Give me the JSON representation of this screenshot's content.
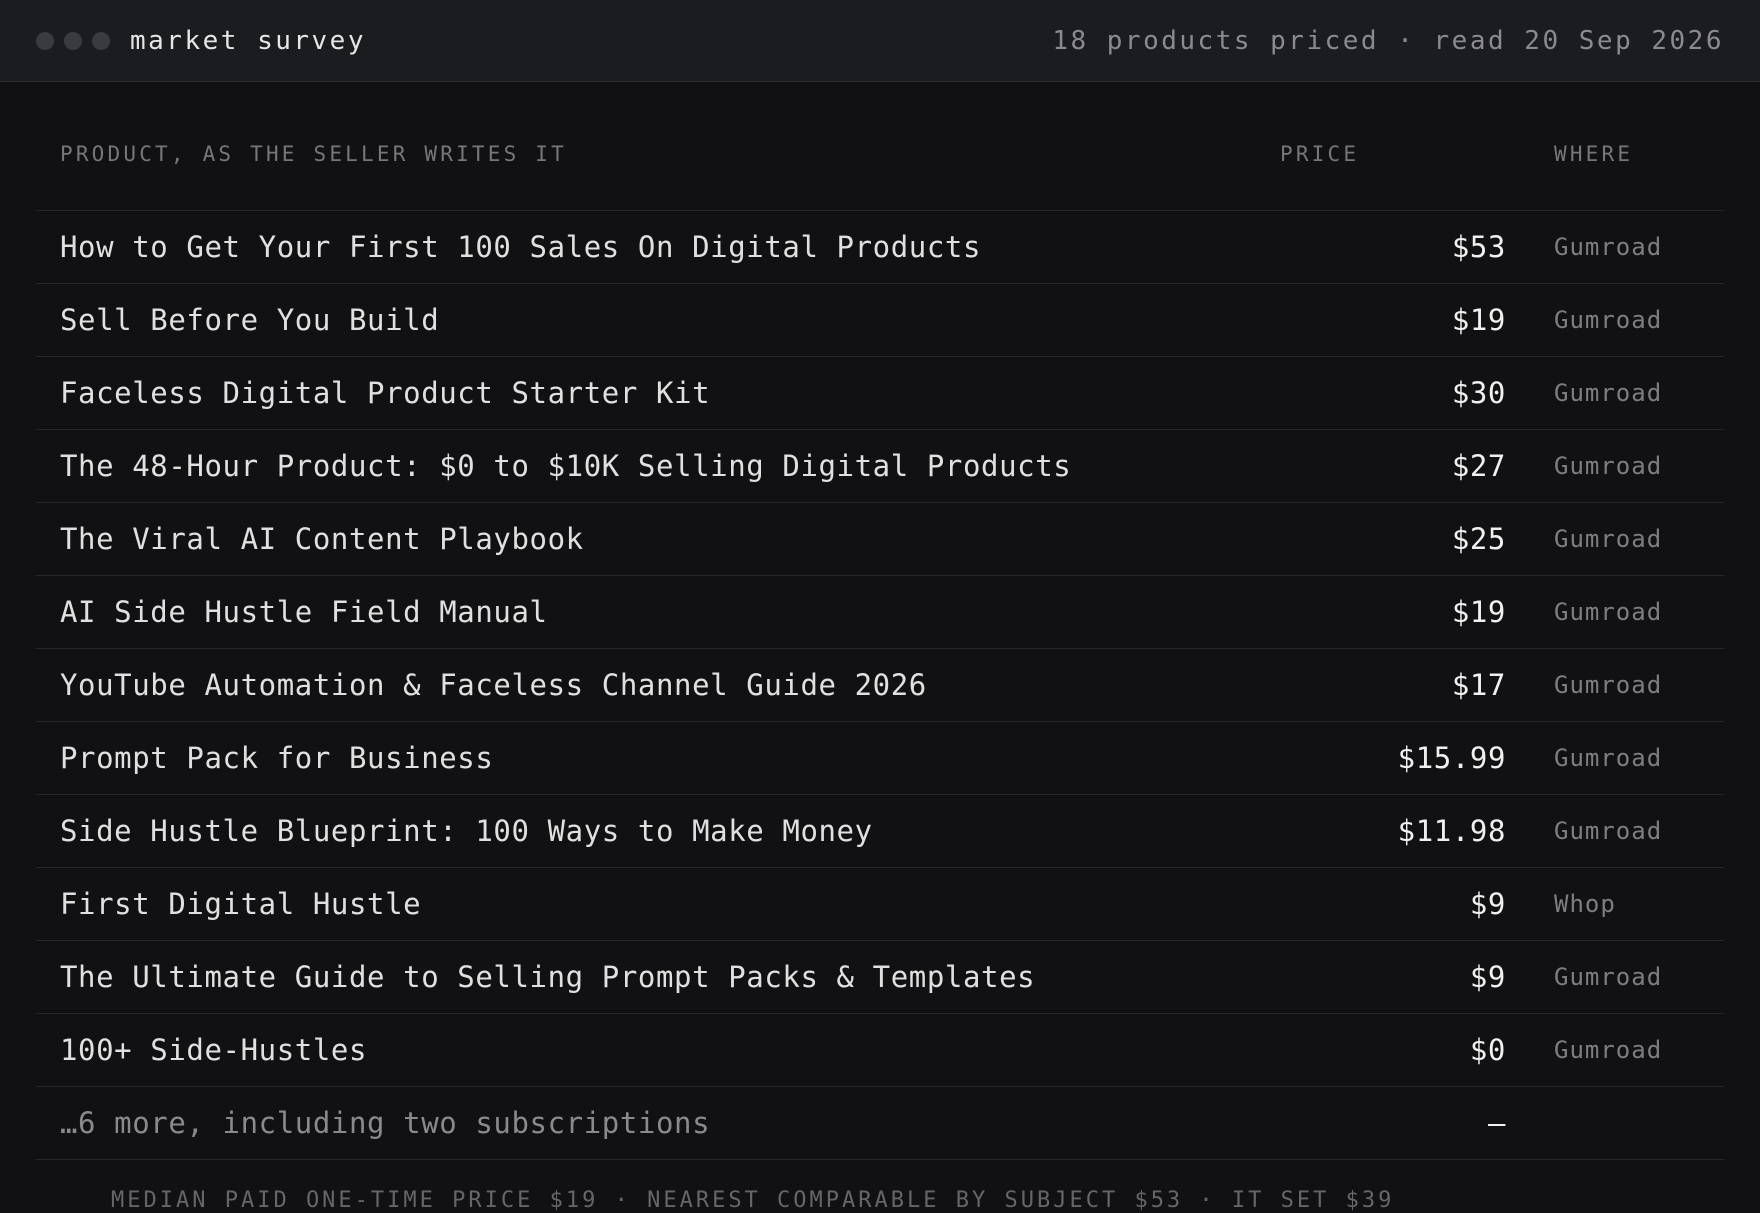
{
  "window": {
    "title": "market survey",
    "status": "18 products priced · read 20 Sep 2026"
  },
  "table": {
    "headers": {
      "product": "PRODUCT, AS THE SELLER WRITES IT",
      "price": "PRICE",
      "where": "WHERE"
    },
    "rows": [
      {
        "product": "How to Get Your First 100 Sales On Digital Products",
        "price": "$53",
        "where": "Gumroad"
      },
      {
        "product": "Sell Before You Build",
        "price": "$19",
        "where": "Gumroad"
      },
      {
        "product": "Faceless Digital Product Starter Kit",
        "price": "$30",
        "where": "Gumroad"
      },
      {
        "product": "The 48-Hour Product: $0 to $10K Selling Digital Products",
        "price": "$27",
        "where": "Gumroad"
      },
      {
        "product": "The Viral AI Content Playbook",
        "price": "$25",
        "where": "Gumroad"
      },
      {
        "product": "AI Side Hustle Field Manual",
        "price": "$19",
        "where": "Gumroad"
      },
      {
        "product": "YouTube Automation & Faceless Channel Guide 2026",
        "price": "$17",
        "where": "Gumroad"
      },
      {
        "product": "Prompt Pack for Business",
        "price": "$15.99",
        "where": "Gumroad"
      },
      {
        "product": "Side Hustle Blueprint: 100 Ways to Make Money",
        "price": "$11.98",
        "where": "Gumroad"
      },
      {
        "product": "First Digital Hustle",
        "price": "$9",
        "where": "Whop"
      },
      {
        "product": "The Ultimate Guide to Selling Prompt Packs & Templates",
        "price": "$9",
        "where": "Gumroad"
      },
      {
        "product": "100+ Side-Hustles",
        "price": "$0",
        "where": "Gumroad"
      }
    ],
    "more_row": {
      "product": "…6 more, including two subscriptions",
      "price": "—",
      "where": ""
    }
  },
  "footer": {
    "summary": "MEDIAN PAID ONE-TIME PRICE $19 · NEAREST COMPARABLE BY SUBJECT $53 · IT SET $39"
  },
  "colors": {
    "background": "#111113",
    "titlebar": "#1b1c20",
    "text": "#e0e0e0",
    "muted": "#7e7e82"
  }
}
